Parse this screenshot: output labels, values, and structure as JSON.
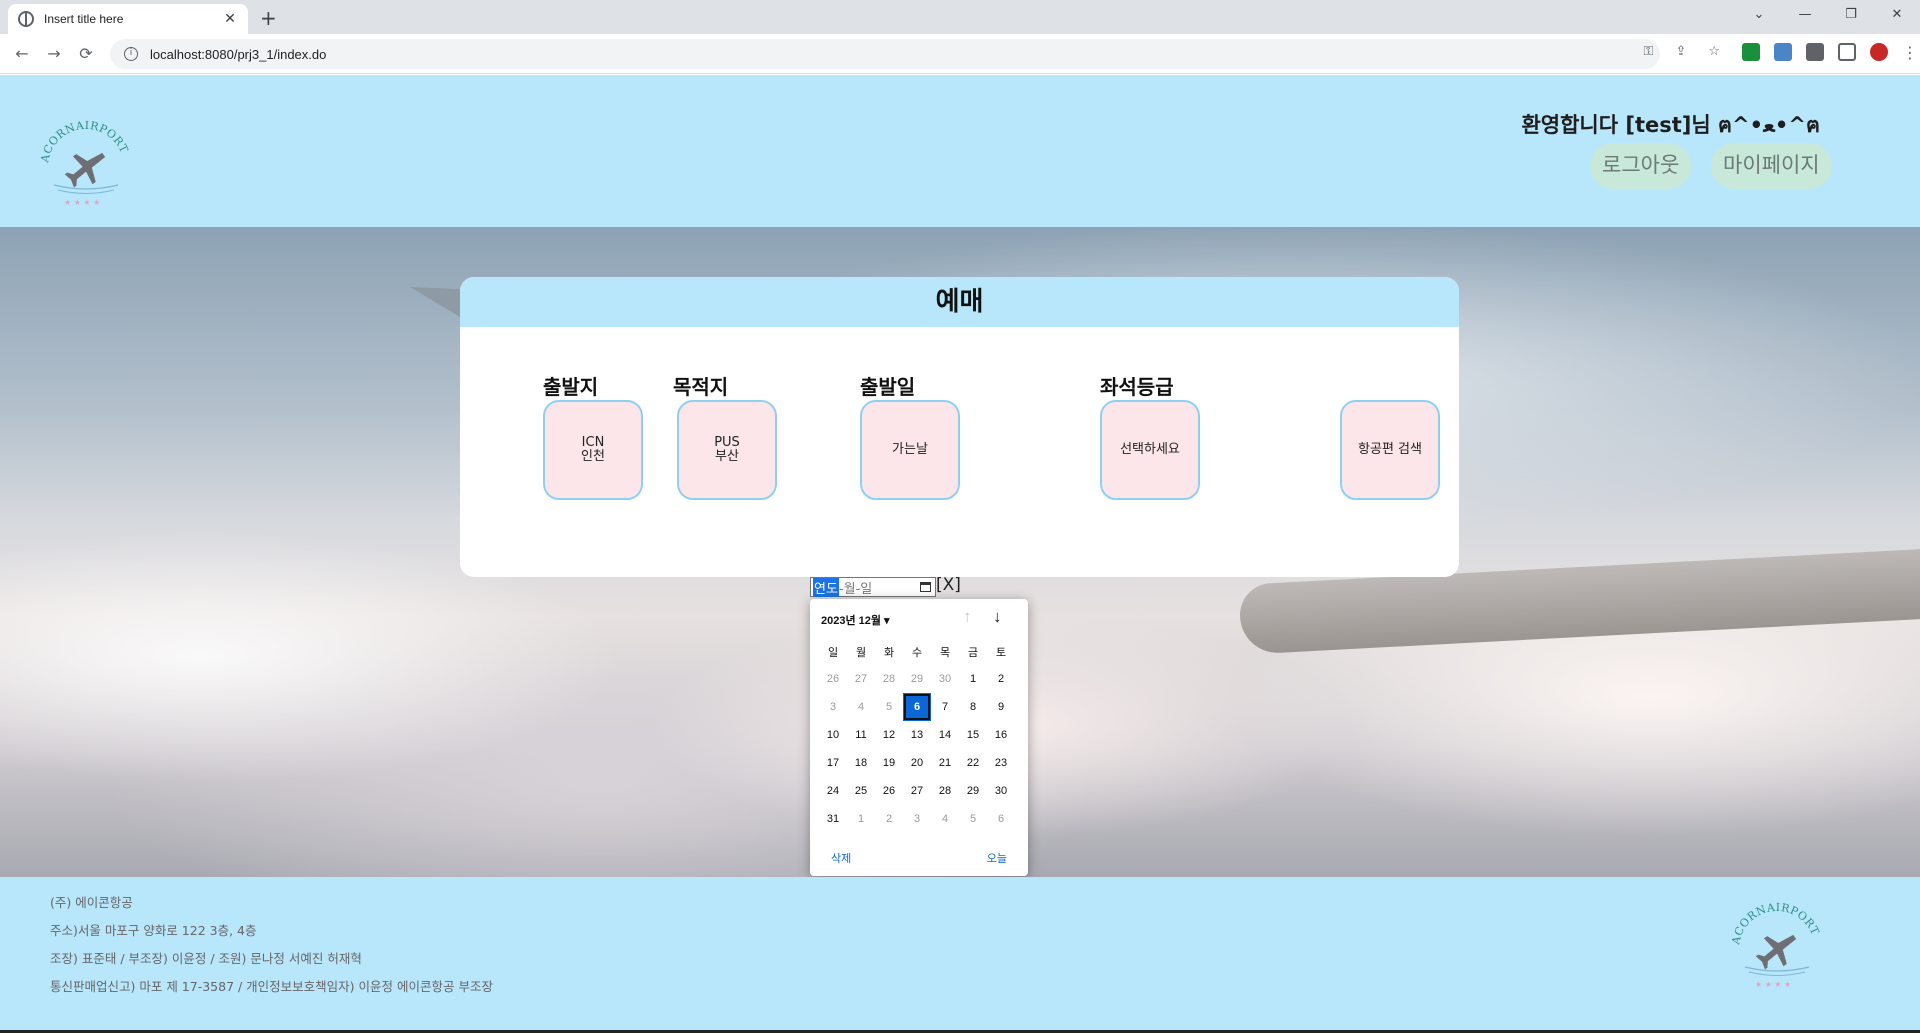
{
  "browser": {
    "tab_title": "Insert title here",
    "tab_close": "✕",
    "new_tab": "+",
    "url": "localhost:8080/prj3_1/index.do",
    "window_buttons": [
      "⌄",
      "—",
      "❐",
      "✕"
    ]
  },
  "header": {
    "logo_text": "ACORNAIRPORT",
    "welcome": "환영합니다 [test]님 ฅ^•ﻌ•^ฅ",
    "logout_label": "로그아웃",
    "mypage_label": "마이페이지"
  },
  "booking": {
    "title": "예매",
    "fields": [
      {
        "label": "출발지",
        "line1": "ICN",
        "line2": "인천"
      },
      {
        "label": "목적지",
        "line1": "PUS",
        "line2": "부산"
      },
      {
        "label": "출발일",
        "line1": "가는날",
        "line2": ""
      },
      {
        "label": "좌석등급",
        "line1": "선택하세요",
        "line2": ""
      },
      {
        "label": "",
        "line1": "항공편 검색",
        "line2": ""
      }
    ]
  },
  "date_input": {
    "year": "연도",
    "rest": "-월-일",
    "close": "[X]"
  },
  "calendar": {
    "month_label": "2023년 12월 ▾",
    "up_arrow": "↑",
    "down_arrow": "↓",
    "weekdays": [
      "일",
      "월",
      "화",
      "수",
      "목",
      "금",
      "토"
    ],
    "weeks": [
      [
        "26",
        "27",
        "28",
        "29",
        "30",
        "1",
        "2"
      ],
      [
        "3",
        "4",
        "5",
        "6",
        "7",
        "8",
        "9"
      ],
      [
        "10",
        "11",
        "12",
        "13",
        "14",
        "15",
        "16"
      ],
      [
        "17",
        "18",
        "19",
        "20",
        "21",
        "22",
        "23"
      ],
      [
        "24",
        "25",
        "26",
        "27",
        "28",
        "29",
        "30"
      ],
      [
        "31",
        "1",
        "2",
        "3",
        "4",
        "5",
        "6"
      ]
    ],
    "selected_date": "6",
    "clear_label": "삭제",
    "today_label": "오늘"
  },
  "footer": {
    "lines": [
      "(주) 에이콘항공",
      "주소)서울 마포구 양화로 122 3층, 4층",
      "조장) 표준태 / 부조장) 이윤정 / 조원) 문나정 서예진 허재혁",
      "통신판매업신고) 마포 제 17-3587 / 개인정보보호책임자) 이윤정 에이콘항공 부조장"
    ]
  },
  "colors": {
    "header_bg": "#b8e6fb",
    "field_bg": "#fde6e9",
    "field_border": "#8fd0f0",
    "button_bg": "#c8e8d9",
    "selected_day": "#0b67d8"
  }
}
